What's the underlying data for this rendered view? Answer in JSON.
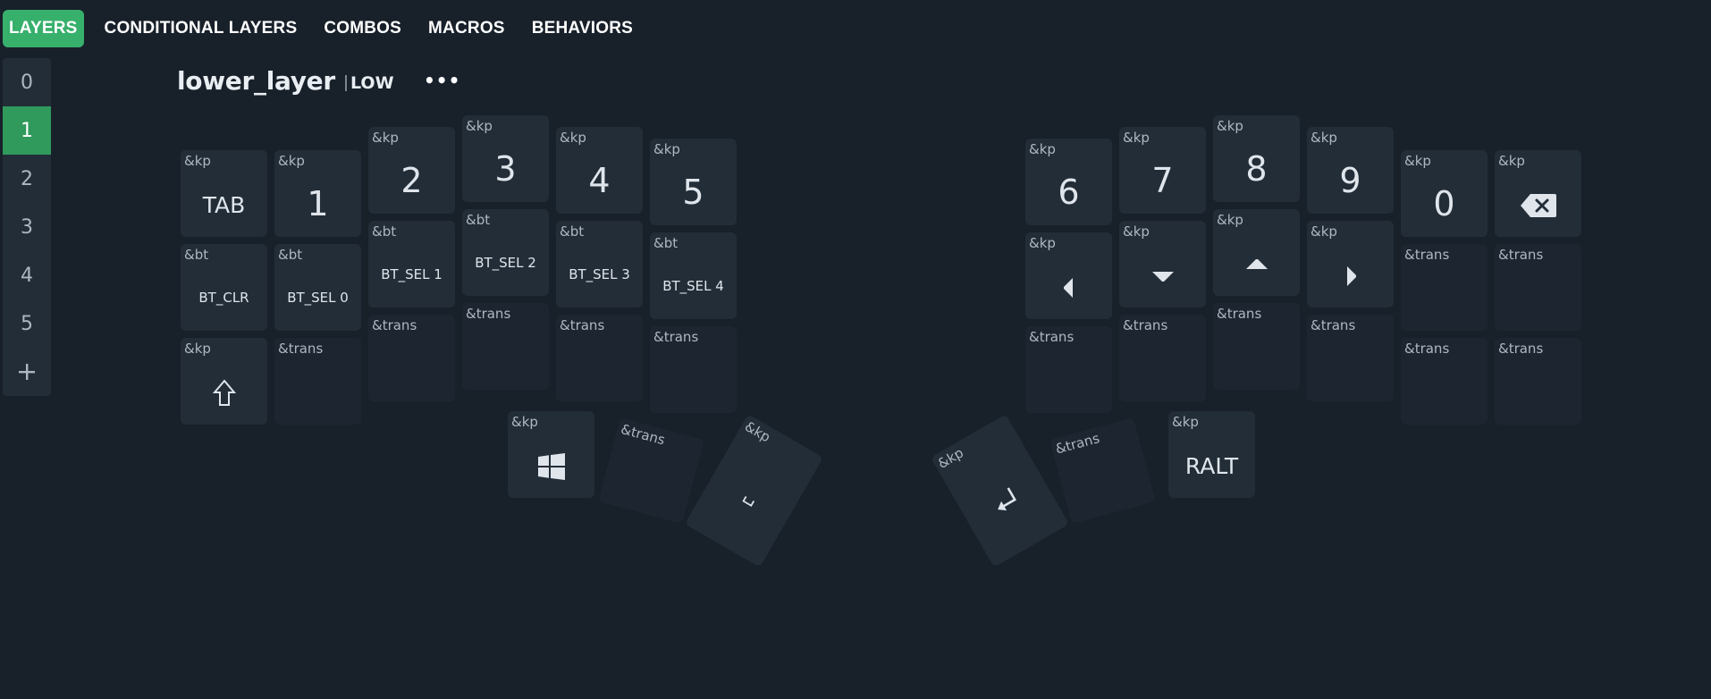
{
  "nav": {
    "tabs": [
      {
        "label": "LAYERS"
      },
      {
        "label": "CONDITIONAL LAYERS"
      },
      {
        "label": "COMBOS"
      },
      {
        "label": "MACROS"
      },
      {
        "label": "BEHAVIORS"
      }
    ],
    "active_tab": "LAYERS",
    "accent_color": "#37b06c"
  },
  "layers": {
    "items": [
      "0",
      "1",
      "2",
      "3",
      "4",
      "5"
    ],
    "selected": "1",
    "add_icon": "plus-icon"
  },
  "layer": {
    "name": "lower_layer",
    "short_name": "LOW",
    "menu_label": "•••"
  },
  "keys": {
    "l_r1_1": {
      "behavior": "&kp",
      "label": "TAB"
    },
    "l_r1_2": {
      "behavior": "&kp",
      "label": "1"
    },
    "l_r1_3": {
      "behavior": "&kp",
      "label": "2"
    },
    "l_r1_4": {
      "behavior": "&kp",
      "label": "3"
    },
    "l_r1_5": {
      "behavior": "&kp",
      "label": "4"
    },
    "l_r1_6": {
      "behavior": "&kp",
      "label": "5"
    },
    "l_r2_1": {
      "behavior": "&bt",
      "label": "BT_CLR"
    },
    "l_r2_2": {
      "behavior": "&bt",
      "label": "BT_SEL 0"
    },
    "l_r2_3": {
      "behavior": "&bt",
      "label": "BT_SEL 1"
    },
    "l_r2_4": {
      "behavior": "&bt",
      "label": "BT_SEL 2"
    },
    "l_r2_5": {
      "behavior": "&bt",
      "label": "BT_SEL 3"
    },
    "l_r2_6": {
      "behavior": "&bt",
      "label": "BT_SEL 4"
    },
    "l_r3_1": {
      "behavior": "&kp",
      "label": "",
      "icon": "shift-arrow-icon"
    },
    "l_r3_2": {
      "behavior": "&trans",
      "label": ""
    },
    "l_r3_3": {
      "behavior": "&trans",
      "label": ""
    },
    "l_r3_4": {
      "behavior": "&trans",
      "label": ""
    },
    "l_r3_5": {
      "behavior": "&trans",
      "label": ""
    },
    "l_r3_6": {
      "behavior": "&trans",
      "label": ""
    },
    "l_th_1": {
      "behavior": "&kp",
      "label": "",
      "icon": "windows-icon"
    },
    "l_th_2": {
      "behavior": "&trans",
      "label": ""
    },
    "l_th_3": {
      "behavior": "&kp",
      "label": "",
      "icon": "space-icon"
    },
    "r_r1_1": {
      "behavior": "&kp",
      "label": "6"
    },
    "r_r1_2": {
      "behavior": "&kp",
      "label": "7"
    },
    "r_r1_3": {
      "behavior": "&kp",
      "label": "8"
    },
    "r_r1_4": {
      "behavior": "&kp",
      "label": "9"
    },
    "r_r1_5": {
      "behavior": "&kp",
      "label": "0"
    },
    "r_r1_6": {
      "behavior": "&kp",
      "label": "",
      "icon": "backspace-icon"
    },
    "r_r2_1": {
      "behavior": "&kp",
      "label": "",
      "icon": "arrow-left-icon"
    },
    "r_r2_2": {
      "behavior": "&kp",
      "label": "",
      "icon": "arrow-down-icon"
    },
    "r_r2_3": {
      "behavior": "&kp",
      "label": "",
      "icon": "arrow-up-icon"
    },
    "r_r2_4": {
      "behavior": "&kp",
      "label": "",
      "icon": "arrow-right-icon"
    },
    "r_r2_5": {
      "behavior": "&trans",
      "label": ""
    },
    "r_r2_6": {
      "behavior": "&trans",
      "label": ""
    },
    "r_r3_1": {
      "behavior": "&trans",
      "label": ""
    },
    "r_r3_2": {
      "behavior": "&trans",
      "label": ""
    },
    "r_r3_3": {
      "behavior": "&trans",
      "label": ""
    },
    "r_r3_4": {
      "behavior": "&trans",
      "label": ""
    },
    "r_r3_5": {
      "behavior": "&trans",
      "label": ""
    },
    "r_r3_6": {
      "behavior": "&trans",
      "label": ""
    },
    "r_th_1": {
      "behavior": "&kp",
      "label": "",
      "icon": "enter-icon"
    },
    "r_th_2": {
      "behavior": "&trans",
      "label": ""
    },
    "r_th_3": {
      "behavior": "&kp",
      "label": "RALT"
    }
  },
  "colors": {
    "background": "#18202a",
    "key": "#222d38",
    "key_trans": "#1d2630",
    "selected_layer": "#2f9a5c"
  }
}
